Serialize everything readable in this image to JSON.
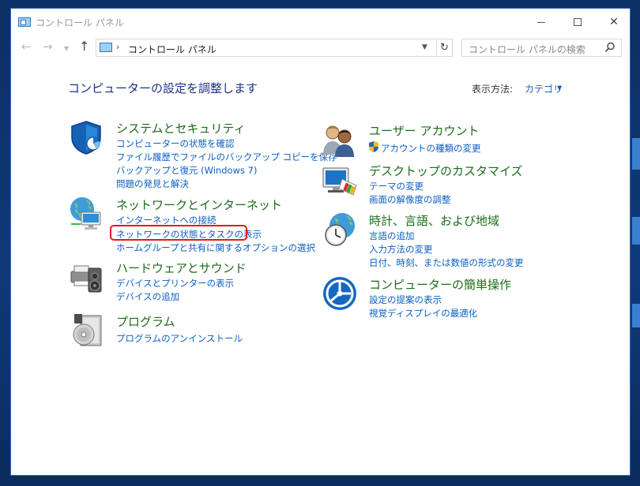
{
  "window": {
    "title": "コントロール パネル",
    "minimize_label": "",
    "maximize_label": "",
    "close_label": "✕"
  },
  "nav": {
    "back": "←",
    "forward": "→",
    "up": "↑",
    "address_path": "コントロール パネル",
    "address_separator": "›",
    "refresh": "↻",
    "search_placeholder": "コントロール パネルの検索"
  },
  "header": {
    "title": "コンピューターの設定を調整します",
    "view_by_label": "表示方法:",
    "view_by_value": "カテゴリ"
  },
  "left_categories": [
    {
      "title": "システムとセキュリティ",
      "icon": "shield-icon",
      "links": [
        "コンピューターの状態を確認",
        "ファイル履歴でファイルのバックアップ コピーを保存",
        "バックアップと復元 (Windows 7)",
        "問題の発見と解決"
      ]
    },
    {
      "title": "ネットワークとインターネット",
      "icon": "network-globe-icon",
      "links": [
        "インターネットへの接続",
        "ネットワークの状態とタスクの表示",
        "ホームグループと共有に関するオプションの選択"
      ]
    },
    {
      "title": "ハードウェアとサウンド",
      "icon": "printer-speaker-icon",
      "links": [
        "デバイスとプリンターの表示",
        "デバイスの追加"
      ]
    },
    {
      "title": "プログラム",
      "icon": "program-disc-icon",
      "links": [
        "プログラムのアンインストール"
      ]
    }
  ],
  "right_categories": [
    {
      "title": "ユーザー アカウント",
      "icon": "users-icon",
      "links": [
        "アカウントの種類の変更"
      ]
    },
    {
      "title": "デスクトップのカスタマイズ",
      "icon": "monitor-palette-icon",
      "links": [
        "テーマの変更",
        "画面の解像度の調整"
      ]
    },
    {
      "title": "時計、言語、および地域",
      "icon": "globe-clock-icon",
      "links": [
        "言語の追加",
        "入力方法の変更",
        "日付、時刻、または数値の形式の変更"
      ]
    },
    {
      "title": "コンピューターの簡単操作",
      "icon": "accessibility-icon",
      "links": [
        "設定の提案の表示",
        "視覚ディスプレイの最適化"
      ]
    }
  ],
  "colors": {
    "category_title": "#1b6c1b",
    "link": "#0a5fc4",
    "heading": "#1e3287",
    "highlight": "#e81818"
  }
}
